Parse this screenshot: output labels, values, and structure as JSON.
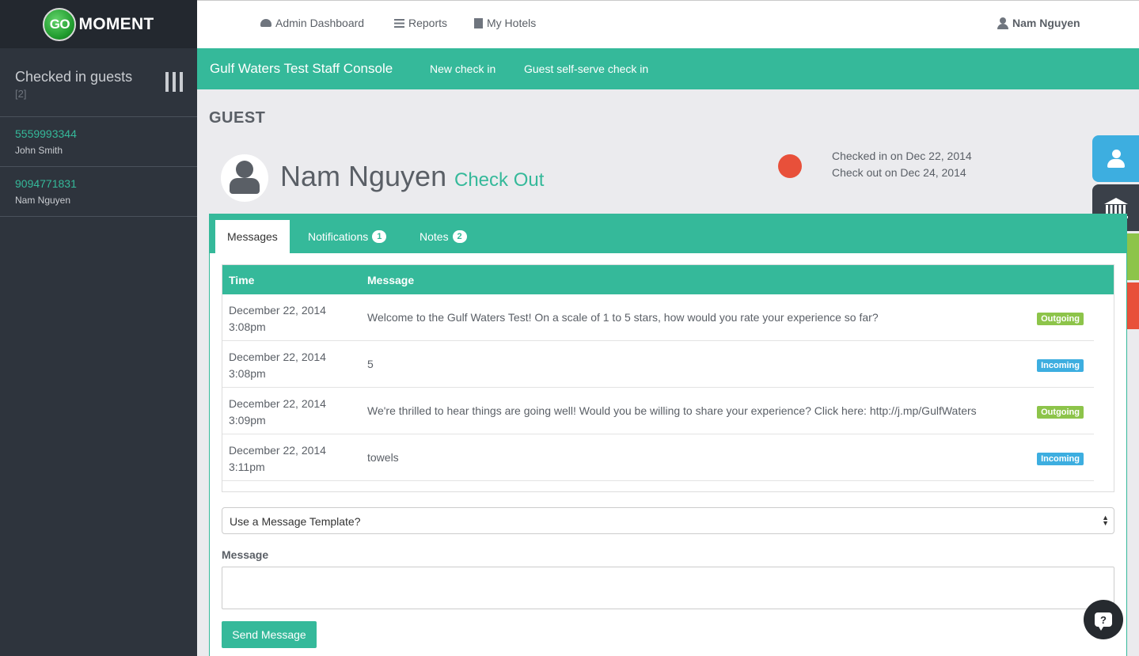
{
  "brand": {
    "logo_go": "GO",
    "logo_moment": "MOMENT"
  },
  "sidebar": {
    "title": "Checked in guests",
    "count": "[2]",
    "guests": [
      {
        "phone": "5559993344",
        "name": "John Smith"
      },
      {
        "phone": "9094771831",
        "name": "Nam Nguyen"
      }
    ]
  },
  "topnav": {
    "admin_dashboard": "Admin Dashboard",
    "reports": "Reports",
    "my_hotels": "My Hotels",
    "user": "Nam Nguyen"
  },
  "subnav": {
    "title": "Gulf Waters Test Staff Console",
    "new_check_in": "New check in",
    "self_serve": "Guest self-serve check in"
  },
  "guest": {
    "section_title": "GUEST",
    "name": "Nam Nguyen",
    "check_out_label": "Check Out",
    "checked_in": "Checked in on Dec 22, 2014",
    "check_out_date": "Check out on Dec 24, 2014"
  },
  "tabs": {
    "messages": "Messages",
    "notifications": "Notifications",
    "notifications_count": "1",
    "notes": "Notes",
    "notes_count": "2"
  },
  "messages": {
    "headers": {
      "time": "Time",
      "message": "Message"
    },
    "rows": [
      {
        "date": "December 22, 2014",
        "time": "3:08pm",
        "text": "Welcome to the Gulf Waters Test! On a scale of 1 to 5 stars, how would you rate your experience so far?",
        "tag": "Outgoing"
      },
      {
        "date": "December 22, 2014",
        "time": "3:08pm",
        "text": "5",
        "tag": "Incoming"
      },
      {
        "date": "December 22, 2014",
        "time": "3:09pm",
        "text": "We're thrilled to hear things are going well! Would you be willing to share your experience? Click here: http://j.mp/GulfWaters",
        "tag": "Outgoing"
      },
      {
        "date": "December 22, 2014",
        "time": "3:11pm",
        "text": "towels",
        "tag": "Incoming"
      }
    ]
  },
  "compose": {
    "template_select": "Use a Message Template?",
    "message_label": "Message",
    "message_value": "",
    "send_label": "Send Message"
  },
  "help": {
    "label": "?"
  },
  "colors": {
    "accent": "#35b99a",
    "sidebar": "#2e343d",
    "outgoing": "#8dc44a",
    "incoming": "#3daee0",
    "status_dot": "#e8503a"
  },
  "icons": {
    "float_buttons": [
      "user-icon",
      "bank-icon",
      "location-pin-icon",
      "hotel-icon"
    ]
  }
}
